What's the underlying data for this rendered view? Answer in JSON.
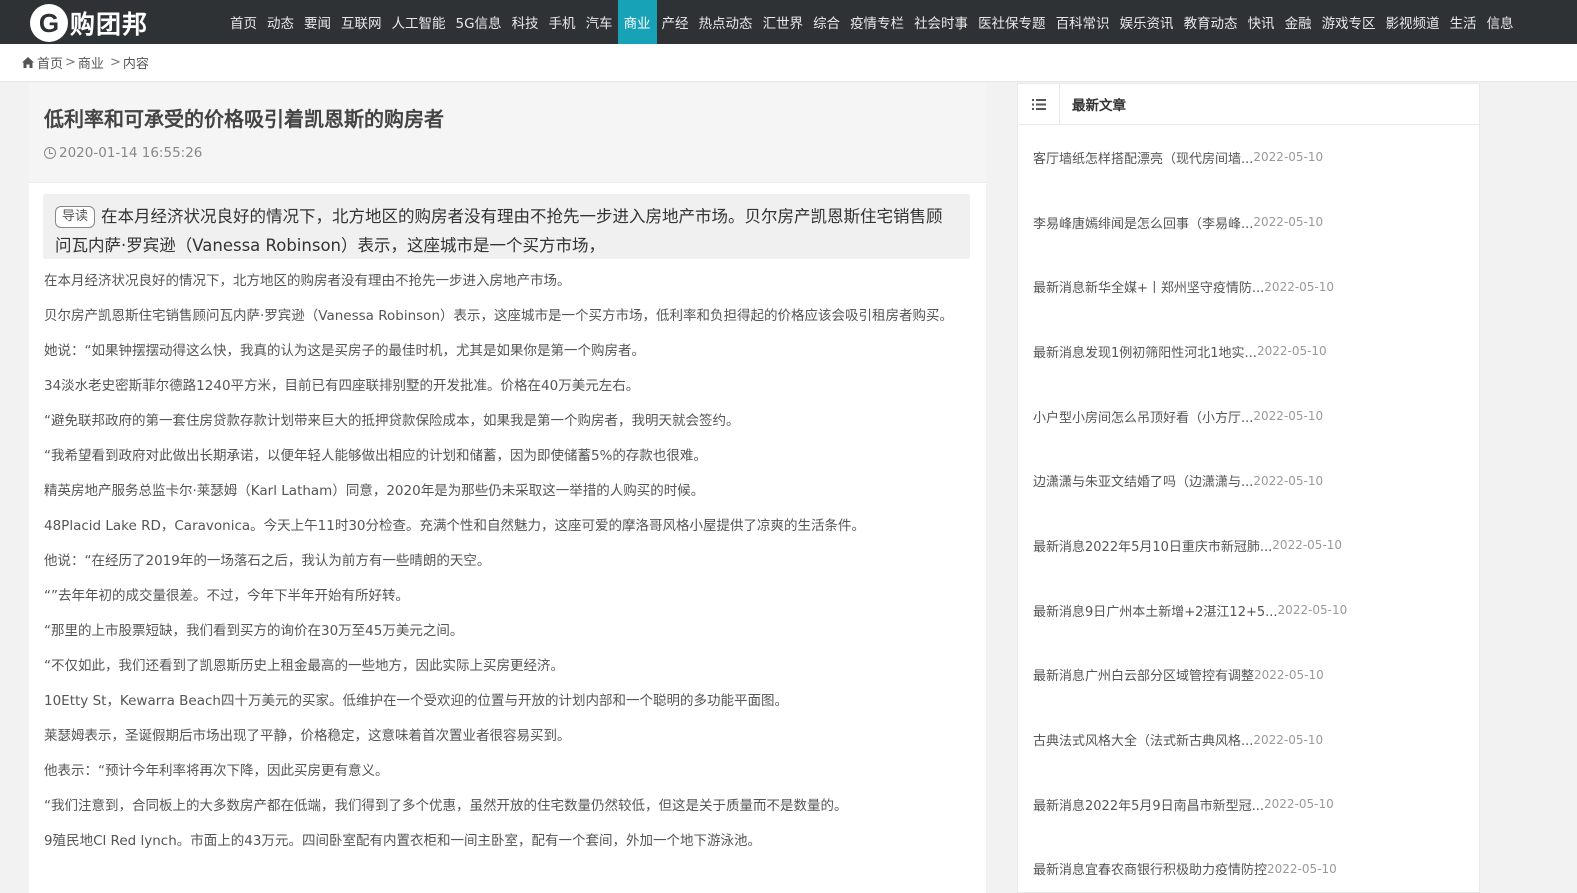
{
  "logo": {
    "mark": "G",
    "text": "购团邦"
  },
  "nav": [
    {
      "label": "首页"
    },
    {
      "label": "动态"
    },
    {
      "label": "要闻"
    },
    {
      "label": "互联网"
    },
    {
      "label": "人工智能"
    },
    {
      "label": "5G信息"
    },
    {
      "label": "科技"
    },
    {
      "label": "手机"
    },
    {
      "label": "汽车"
    },
    {
      "label": "商业",
      "active": true
    },
    {
      "label": "产经"
    },
    {
      "label": "热点动态"
    },
    {
      "label": "汇世界"
    },
    {
      "label": "综合"
    },
    {
      "label": "疫情专栏"
    },
    {
      "label": "社会时事"
    },
    {
      "label": "医社保专题"
    },
    {
      "label": "百科常识"
    },
    {
      "label": "娱乐资讯"
    },
    {
      "label": "教育动态"
    },
    {
      "label": "快讯"
    },
    {
      "label": "金融"
    },
    {
      "label": "游戏专区"
    },
    {
      "label": "影视频道"
    },
    {
      "label": "生活"
    },
    {
      "label": "信息"
    }
  ],
  "breadcrumb": {
    "home": "首页",
    "sep1": ">",
    "section": "商业",
    "sep2": ">",
    "current": "内容"
  },
  "article": {
    "title": "低利率和可承受的价格吸引着凯恩斯的购房者",
    "date": "2020-01-14 16:55:26",
    "summary_tag": "导读",
    "summary": "在本月经济状况良好的情况下，北方地区的购房者没有理由不抢先一步进入房地产市场。贝尔房产凯恩斯住宅销售顾问瓦内萨·罗宾逊（Vanessa Robinson）表示，这座城市是一个买方市场，",
    "paragraphs": [
      "在本月经济状况良好的情况下，北方地区的购房者没有理由不抢先一步进入房地产市场。",
      "贝尔房产凯恩斯住宅销售顾问瓦内萨·罗宾逊（Vanessa Robinson）表示，这座城市是一个买方市场，低利率和负担得起的价格应该会吸引租房者购买。",
      "她说：“如果钟摆摆动得这么快，我真的认为这是买房子的最佳时机，尤其是如果你是第一个购房者。",
      "34淡水老史密斯菲尔德路1240平方米，目前已有四座联排别墅的开发批准。价格在40万美元左右。",
      "“避免联邦政府的第一套住房贷款存款计划带来巨大的抵押贷款保险成本，如果我是第一个购房者，我明天就会签约。",
      "“我希望看到政府对此做出长期承诺，以便年轻人能够做出相应的计划和储蓄，因为即使储蓄5%的存款也很难。",
      "精英房地产服务总监卡尔·莱瑟姆（Karl Latham）同意，2020年是为那些仍未采取这一举措的人购买的时候。",
      "48Placid Lake RD，Caravonica。今天上午11时30分检查。充满个性和自然魅力，这座可爱的摩洛哥风格小屋提供了凉爽的生活条件。",
      "他说：“在经历了2019年的一场落石之后，我认为前方有一些晴朗的天空。",
      "“”去年年初的成交量很差。不过，今年下半年开始有所好转。",
      "“那里的上市股票短缺，我们看到买方的询价在30万至45万美元之间。",
      "“不仅如此，我们还看到了凯恩斯历史上租金最高的一些地方，因此实际上买房更经济。",
      "10Etty St，Kewarra Beach四十万美元的买家。低维护在一个受欢迎的位置与开放的计划内部和一个聪明的多功能平面图。",
      "莱瑟姆表示，圣诞假期后市场出现了平静，价格稳定，这意味着首次置业者很容易买到。",
      "他表示：“预计今年利率将再次下降，因此买房更有意义。",
      "“我们注意到，合同板上的大多数房产都在低端，我们得到了多个优惠，虽然开放的住宅数量仍然较低，但这是关于质量而不是数量的。",
      "9殖民地Cl Red lynch。市面上的43万元。四间卧室配有内置衣柜和一间主卧室，配有一个套间，外加一个地下游泳池。"
    ]
  },
  "sidebar": {
    "title": "最新文章",
    "items": [
      {
        "title": "客厅墙纸怎样搭配漂亮（现代房间墙...",
        "date": "2022-05-10"
      },
      {
        "title": "李易峰唐嫣绯闻是怎么回事（李易峰...",
        "date": "2022-05-10"
      },
      {
        "title": "最新消息新华全媒+丨郑州坚守疫情防...",
        "date": "2022-05-10"
      },
      {
        "title": "最新消息发现1例初筛阳性河北1地实...",
        "date": "2022-05-10"
      },
      {
        "title": "小户型小房间怎么吊顶好看（小方厅...",
        "date": "2022-05-10"
      },
      {
        "title": "边潇潇与朱亚文结婚了吗（边潇潇与...",
        "date": "2022-05-10"
      },
      {
        "title": "最新消息2022年5月10日重庆市新冠肺...",
        "date": "2022-05-10"
      },
      {
        "title": "最新消息9日广州本土新增+2湛江12+5...",
        "date": "2022-05-10"
      },
      {
        "title": "最新消息广州白云部分区域管控有调整",
        "date": "2022-05-10"
      },
      {
        "title": "古典法式风格大全（法式新古典风格...",
        "date": "2022-05-10"
      },
      {
        "title": "最新消息2022年5月9日南昌市新型冠...",
        "date": "2022-05-10"
      },
      {
        "title": "最新消息宜春农商银行积极助力疫情防控",
        "date": "2022-05-10"
      }
    ]
  }
}
